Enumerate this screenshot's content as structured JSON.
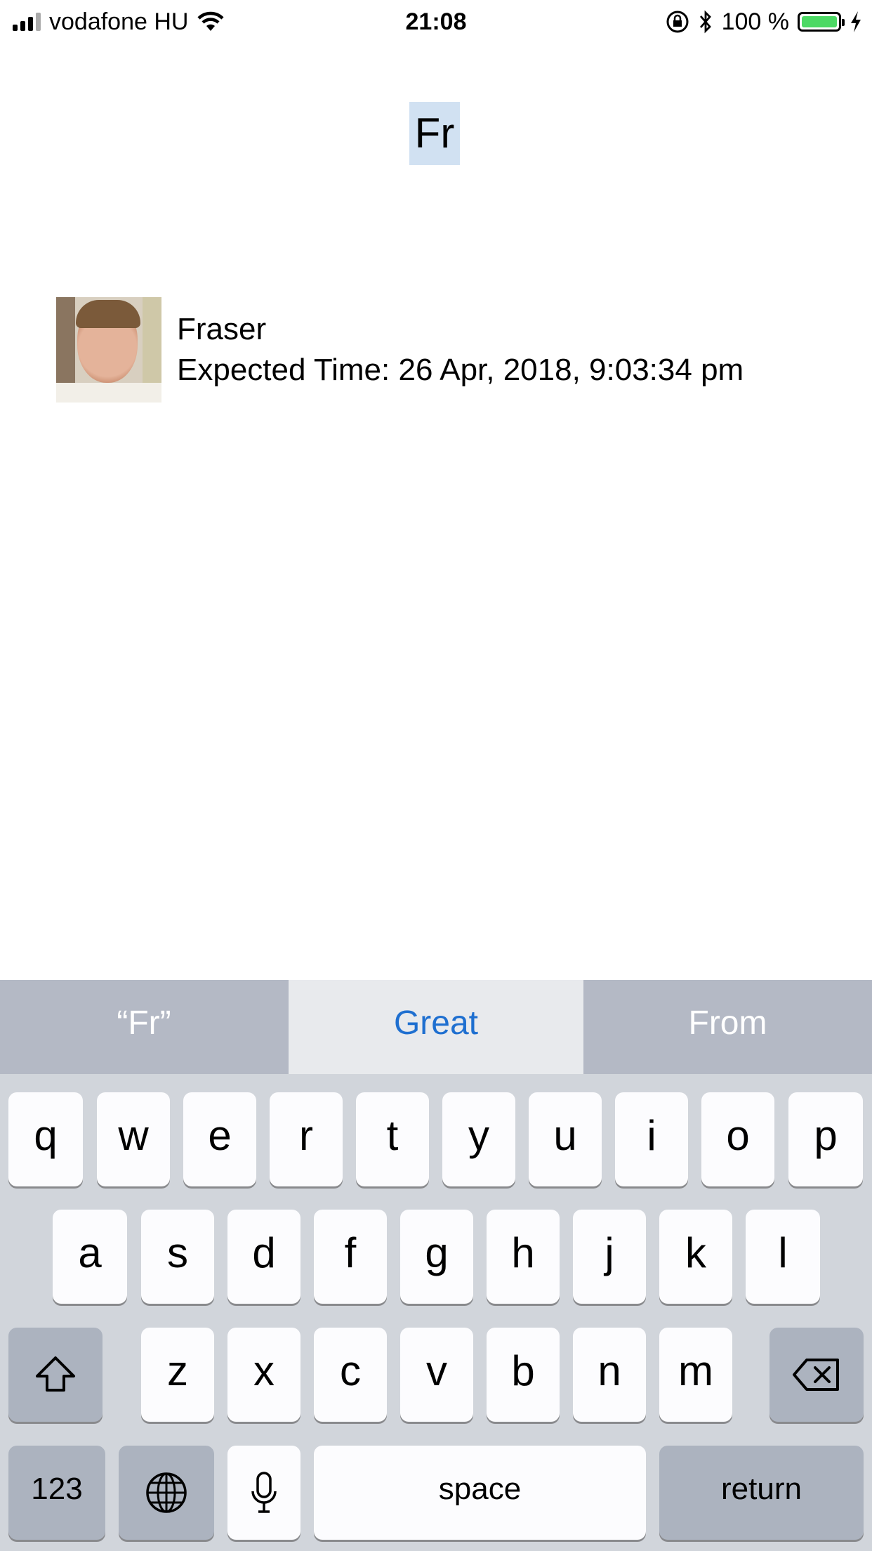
{
  "status_bar": {
    "carrier": "vodafone HU",
    "time": "21:08",
    "battery": "100 %"
  },
  "search": {
    "query": "Fr"
  },
  "result": {
    "name": "Fraser",
    "expected": "Expected Time: 26 Apr, 2018, 9:03:34 pm"
  },
  "keyboard": {
    "suggestions": [
      "“Fr”",
      "Great",
      "From"
    ],
    "row1": [
      "q",
      "w",
      "e",
      "r",
      "t",
      "y",
      "u",
      "i",
      "o",
      "p"
    ],
    "row2": [
      "a",
      "s",
      "d",
      "f",
      "g",
      "h",
      "j",
      "k",
      "l"
    ],
    "row3": [
      "z",
      "x",
      "c",
      "v",
      "b",
      "n",
      "m"
    ],
    "numbers": "123",
    "space": "space",
    "return": "return"
  },
  "colors": {
    "highlight": "#d1e1f2",
    "suggestion_accent": "#1e6fd0",
    "battery": "#4cd964"
  }
}
